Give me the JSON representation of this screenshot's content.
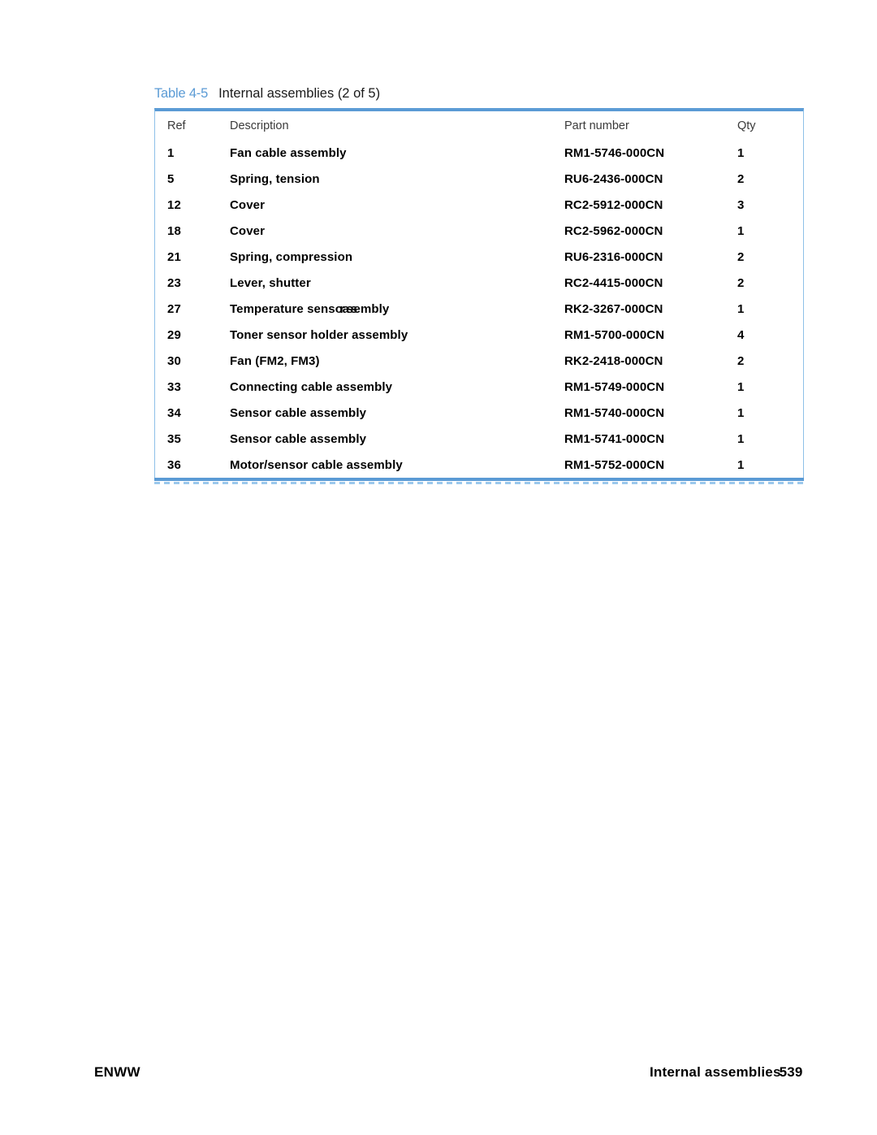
{
  "document": {
    "table_caption": {
      "label": "Table 4-5",
      "title": "Internal assemblies (2 of 5)"
    },
    "table": {
      "columns": [
        "Ref",
        "Description",
        "Part number",
        "Qty"
      ],
      "rows": [
        {
          "ref": "1",
          "description": "Fan cable assembly",
          "part_number": "RM1-5746-000CN",
          "qty": "1"
        },
        {
          "ref": "5",
          "description": "Spring, tension",
          "part_number": "RU6-2436-000CN",
          "qty": "2"
        },
        {
          "ref": "12",
          "description": "Cover",
          "part_number": "RC2-5912-000CN",
          "qty": "3"
        },
        {
          "ref": "18",
          "description": "Cover",
          "part_number": "RC2-5962-000CN",
          "qty": "1"
        },
        {
          "ref": "21",
          "description": "Spring, compression",
          "part_number": "RU6-2316-000CN",
          "qty": "2"
        },
        {
          "ref": "23",
          "description": "Lever, shutter",
          "part_number": "RC2-4415-000CN",
          "qty": "2"
        },
        {
          "ref": "27",
          "description": "Temperature sensor assembly",
          "description_rendered_prefix": "Temperature sens",
          "description_rendered_overlap": "or ass",
          "description_rendered_suffix": "embly",
          "part_number": "RK2-3267-000CN",
          "qty": "1"
        },
        {
          "ref": "29",
          "description": "Toner sensor holder assembly",
          "part_number": "RM1-5700-000CN",
          "qty": "4"
        },
        {
          "ref": "30",
          "description": "Fan (FM2, FM3)",
          "part_number": "RK2-2418-000CN",
          "qty": "2"
        },
        {
          "ref": "33",
          "description": "Connecting cable assembly",
          "part_number": "RM1-5749-000CN",
          "qty": "1"
        },
        {
          "ref": "34",
          "description": "Sensor cable assembly",
          "part_number": "RM1-5740-000CN",
          "qty": "1"
        },
        {
          "ref": "35",
          "description": "Sensor cable assembly",
          "part_number": "RM1-5741-000CN",
          "qty": "1"
        },
        {
          "ref": "36",
          "description": "Motor/sensor cable assembly",
          "part_number": "RM1-5752-000CN",
          "qty": "1"
        }
      ]
    },
    "footer": {
      "left": "ENWW",
      "section": "Internal assemblies",
      "page_number": "539"
    },
    "colors": {
      "accent_blue": "#5B9BD5",
      "rule_light_blue": "#8ec0e8",
      "text_black": "#000000",
      "header_gray": "#3a3a3a"
    }
  }
}
